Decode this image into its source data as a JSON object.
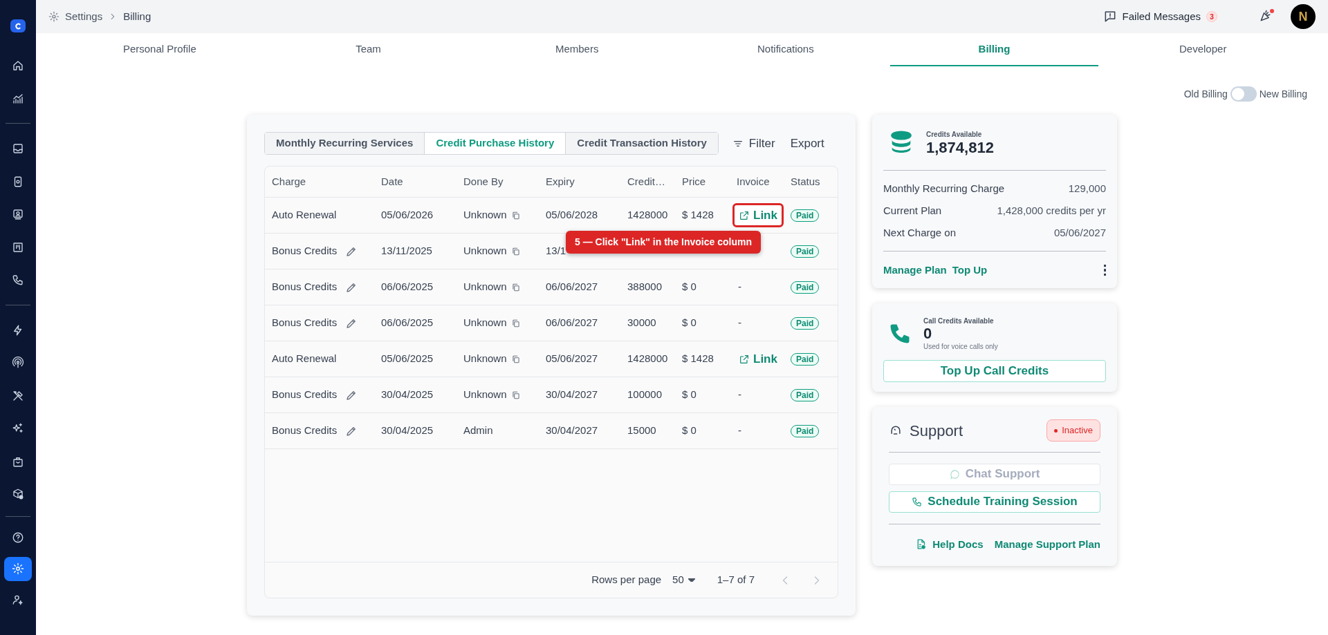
{
  "sidebar": {
    "groups": [
      [
        {
          "selected": false
        },
        {
          "selected": false
        }
      ],
      [
        {
          "selected": false
        },
        {
          "selected": false
        },
        {
          "selected": false
        },
        {
          "selected": false
        },
        {
          "selected": false
        }
      ],
      [
        {
          "selected": false
        },
        {
          "selected": false
        },
        {
          "selected": false
        },
        {
          "selected": false
        },
        {
          "selected": false
        },
        {
          "selected": false
        }
      ]
    ],
    "bottom": [
      {
        "selected": false
      },
      {
        "selected": true
      },
      {
        "selected": false
      }
    ]
  },
  "breadcrumb": [
    "Settings",
    "Billing"
  ],
  "header": {
    "failed_messages": "Failed Messages",
    "failed_count": "3",
    "avatar": "N"
  },
  "tabs": [
    {
      "label": "Personal Profile",
      "selected": false
    },
    {
      "label": "Team",
      "selected": false
    },
    {
      "label": "Members",
      "selected": false
    },
    {
      "label": "Notifications",
      "selected": false
    },
    {
      "label": "Billing",
      "selected": true
    },
    {
      "label": "Developer",
      "selected": false
    }
  ],
  "billing_toggle": {
    "left_label": "Old Billing",
    "right_label": "New Billing",
    "on": false
  },
  "subtabs": [
    {
      "label": "Monthly Recurring Services",
      "selected": false
    },
    {
      "label": "Credit Purchase History",
      "selected": true
    },
    {
      "label": "Credit Transaction History",
      "selected": false
    }
  ],
  "actions": [
    "Filter",
    "Export"
  ],
  "table": {
    "columns": [
      "Charge",
      "Date",
      "Done By",
      "Expiry",
      "Credit…",
      "Price",
      "Invoice",
      "Status"
    ],
    "rows": [
      {
        "charge": "Auto Renewal",
        "editable": false,
        "date": "05/06/2026",
        "done_by": "Unknown",
        "copyable": true,
        "expiry": "05/06/2028",
        "credits": "1428000",
        "price": "$ 1428",
        "invoice": {
          "kind": "link",
          "text": "Link",
          "highlighted": true
        },
        "status": "Paid"
      },
      {
        "charge": "Bonus Credits",
        "editable": true,
        "date": "13/11/2025",
        "done_by": "Unknown",
        "copyable": true,
        "expiry": "13/1",
        "status": "Paid"
      },
      {
        "charge": "Bonus Credits",
        "editable": true,
        "date": "06/06/2025",
        "done_by": "Unknown",
        "copyable": true,
        "expiry": "06/06/2027",
        "credits": "388000",
        "price": "$ 0",
        "invoice": {
          "kind": "none",
          "text": "-"
        },
        "status": "Paid"
      },
      {
        "charge": "Bonus Credits",
        "editable": true,
        "date": "06/06/2025",
        "done_by": "Unknown",
        "copyable": true,
        "expiry": "06/06/2027",
        "credits": "30000",
        "price": "$ 0",
        "invoice": {
          "kind": "none",
          "text": "-"
        },
        "status": "Paid"
      },
      {
        "charge": "Auto Renewal",
        "editable": false,
        "date": "05/06/2025",
        "done_by": "Unknown",
        "copyable": true,
        "expiry": "05/06/2027",
        "credits": "1428000",
        "price": "$ 1428",
        "invoice": {
          "kind": "link",
          "text": "Link",
          "highlighted": false
        },
        "status": "Paid"
      },
      {
        "charge": "Bonus Credits",
        "editable": true,
        "date": "30/04/2025",
        "done_by": "Unknown",
        "copyable": true,
        "expiry": "30/04/2027",
        "credits": "100000",
        "price": "$ 0",
        "invoice": {
          "kind": "none",
          "text": "-"
        },
        "status": "Paid"
      },
      {
        "charge": "Bonus Credits",
        "editable": true,
        "date": "30/04/2025",
        "done_by": "Admin",
        "copyable": false,
        "expiry": "30/04/2027",
        "credits": "15000",
        "price": "$ 0",
        "invoice": {
          "kind": "none",
          "text": "-"
        },
        "status": "Paid"
      }
    ]
  },
  "callout": {
    "text": "5 — Click \"Link\" in the Invoice column"
  },
  "pagination": {
    "rows_per_page_label": "Rows per page",
    "rows_per_page": "50",
    "range": "1–7 of 7"
  },
  "credits_card": {
    "label": "Credits Available",
    "value": "1,874,812",
    "details": [
      {
        "label": "Monthly Recurring Charge",
        "value": "129,000"
      },
      {
        "label": "Current Plan",
        "value": "1,428,000 credits per yr"
      },
      {
        "label": "Next Charge on",
        "value": "05/06/2027"
      }
    ],
    "actions": [
      "Manage Plan",
      "Top Up"
    ]
  },
  "call_credits_card": {
    "label": "Call Credits Available",
    "value": "0",
    "note": "Used for voice calls only",
    "button": "Top Up Call Credits"
  },
  "support_card": {
    "title": "Support",
    "status": "Inactive",
    "buttons": [
      {
        "label": "Chat Support",
        "disabled": true,
        "kind": "chat"
      },
      {
        "label": "Schedule Training Session",
        "disabled": false,
        "kind": "phone"
      }
    ],
    "links": [
      "Help Docs",
      "Manage Support Plan"
    ]
  }
}
